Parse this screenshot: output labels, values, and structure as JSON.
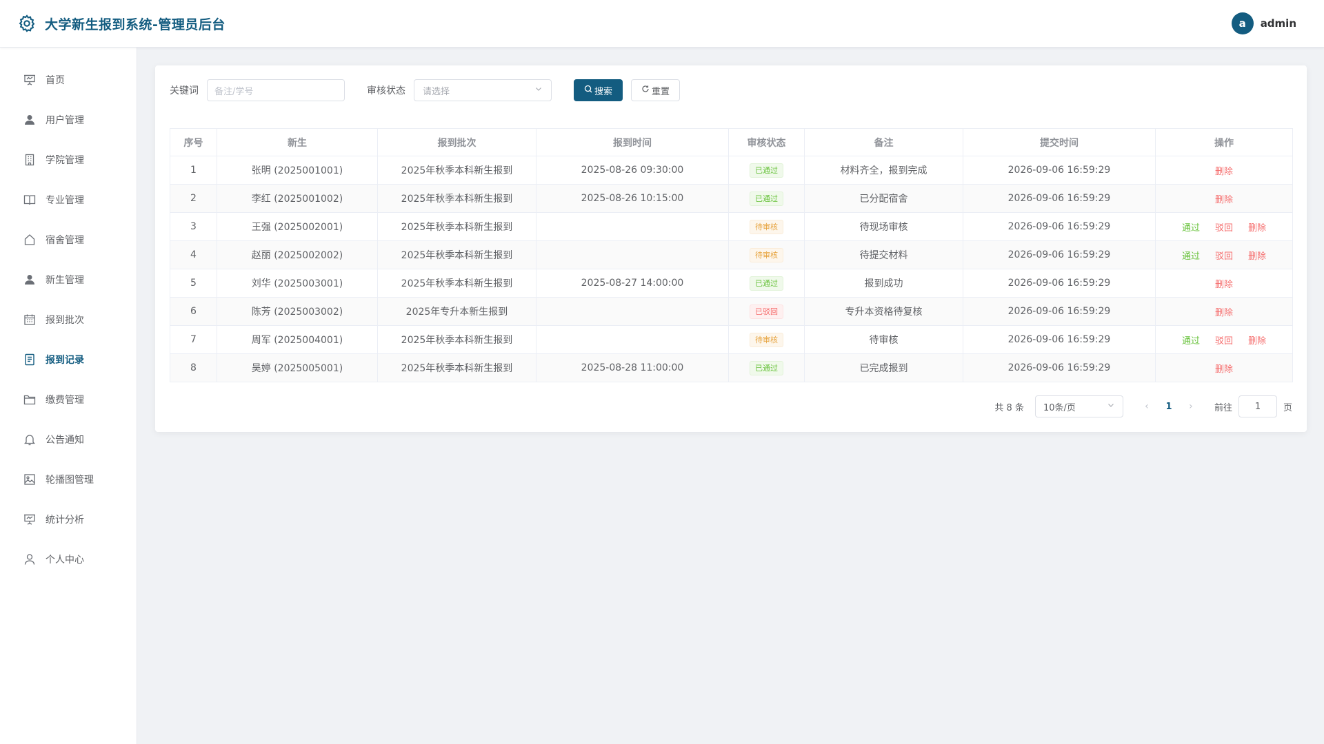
{
  "header": {
    "title": "大学新生报到系统-管理员后台",
    "avatar_letter": "a",
    "username": "admin"
  },
  "sidebar": {
    "items": [
      {
        "label": "首页",
        "icon": "presentation-icon",
        "active": false
      },
      {
        "label": "用户管理",
        "icon": "user-filled-icon",
        "active": false
      },
      {
        "label": "学院管理",
        "icon": "building-icon",
        "active": false
      },
      {
        "label": "专业管理",
        "icon": "book-icon",
        "active": false
      },
      {
        "label": "宿舍管理",
        "icon": "house-icon",
        "active": false
      },
      {
        "label": "新生管理",
        "icon": "user-filled-icon",
        "active": false
      },
      {
        "label": "报到批次",
        "icon": "calendar-icon",
        "active": false
      },
      {
        "label": "报到记录",
        "icon": "document-icon",
        "active": true
      },
      {
        "label": "缴费管理",
        "icon": "folder-icon",
        "active": false
      },
      {
        "label": "公告通知",
        "icon": "bell-icon",
        "active": false
      },
      {
        "label": "轮播图管理",
        "icon": "picture-icon",
        "active": false
      },
      {
        "label": "统计分析",
        "icon": "presentation-icon",
        "active": false
      },
      {
        "label": "个人中心",
        "icon": "user-icon",
        "active": false
      }
    ]
  },
  "filters": {
    "keyword_label": "关键词",
    "keyword_placeholder": "备注/学号",
    "status_label": "审核状态",
    "status_placeholder": "请选择",
    "search_label": "搜索",
    "reset_label": "重置"
  },
  "table": {
    "columns": [
      "序号",
      "新生",
      "报到批次",
      "报到时间",
      "审核状态",
      "备注",
      "提交时间",
      "操作"
    ],
    "rows": [
      {
        "index": "1",
        "student": "张明 (2025001001)",
        "batch": "2025年秋季本科新生报到",
        "checkin_time": "2025-08-26 09:30:00",
        "status": "已通过",
        "status_type": "success",
        "remark": "材料齐全，报到完成",
        "submit_time": "2026-09-06 16:59:29",
        "actions": [
          "删除"
        ]
      },
      {
        "index": "2",
        "student": "李红 (2025001002)",
        "batch": "2025年秋季本科新生报到",
        "checkin_time": "2025-08-26 10:15:00",
        "status": "已通过",
        "status_type": "success",
        "remark": "已分配宿舍",
        "submit_time": "2026-09-06 16:59:29",
        "actions": [
          "删除"
        ]
      },
      {
        "index": "3",
        "student": "王强 (2025002001)",
        "batch": "2025年秋季本科新生报到",
        "checkin_time": "",
        "status": "待审核",
        "status_type": "warning",
        "remark": "待现场审核",
        "submit_time": "2026-09-06 16:59:29",
        "actions": [
          "通过",
          "驳回",
          "删除"
        ]
      },
      {
        "index": "4",
        "student": "赵丽 (2025002002)",
        "batch": "2025年秋季本科新生报到",
        "checkin_time": "",
        "status": "待审核",
        "status_type": "warning",
        "remark": "待提交材料",
        "submit_time": "2026-09-06 16:59:29",
        "actions": [
          "通过",
          "驳回",
          "删除"
        ]
      },
      {
        "index": "5",
        "student": "刘华 (2025003001)",
        "batch": "2025年秋季本科新生报到",
        "checkin_time": "2025-08-27 14:00:00",
        "status": "已通过",
        "status_type": "success",
        "remark": "报到成功",
        "submit_time": "2026-09-06 16:59:29",
        "actions": [
          "删除"
        ]
      },
      {
        "index": "6",
        "student": "陈芳 (2025003002)",
        "batch": "2025年专升本新生报到",
        "checkin_time": "",
        "status": "已驳回",
        "status_type": "danger",
        "remark": "专升本资格待复核",
        "submit_time": "2026-09-06 16:59:29",
        "actions": [
          "删除"
        ]
      },
      {
        "index": "7",
        "student": "周军 (2025004001)",
        "batch": "2025年秋季本科新生报到",
        "checkin_time": "",
        "status": "待审核",
        "status_type": "warning",
        "remark": "待审核",
        "submit_time": "2026-09-06 16:59:29",
        "actions": [
          "通过",
          "驳回",
          "删除"
        ]
      },
      {
        "index": "8",
        "student": "吴婷 (2025005001)",
        "batch": "2025年秋季本科新生报到",
        "checkin_time": "2025-08-28 11:00:00",
        "status": "已通过",
        "status_type": "success",
        "remark": "已完成报到",
        "submit_time": "2026-09-06 16:59:29",
        "actions": [
          "删除"
        ]
      }
    ]
  },
  "pagination": {
    "total_text": "共 8 条",
    "page_size": "10条/页",
    "current_page": "1",
    "goto_label": "前往",
    "goto_value": "1",
    "page_suffix": "页"
  },
  "colors": {
    "primary": "#135c80",
    "success": "#67c23a",
    "warning": "#e6a23c",
    "danger": "#f56c6c"
  }
}
